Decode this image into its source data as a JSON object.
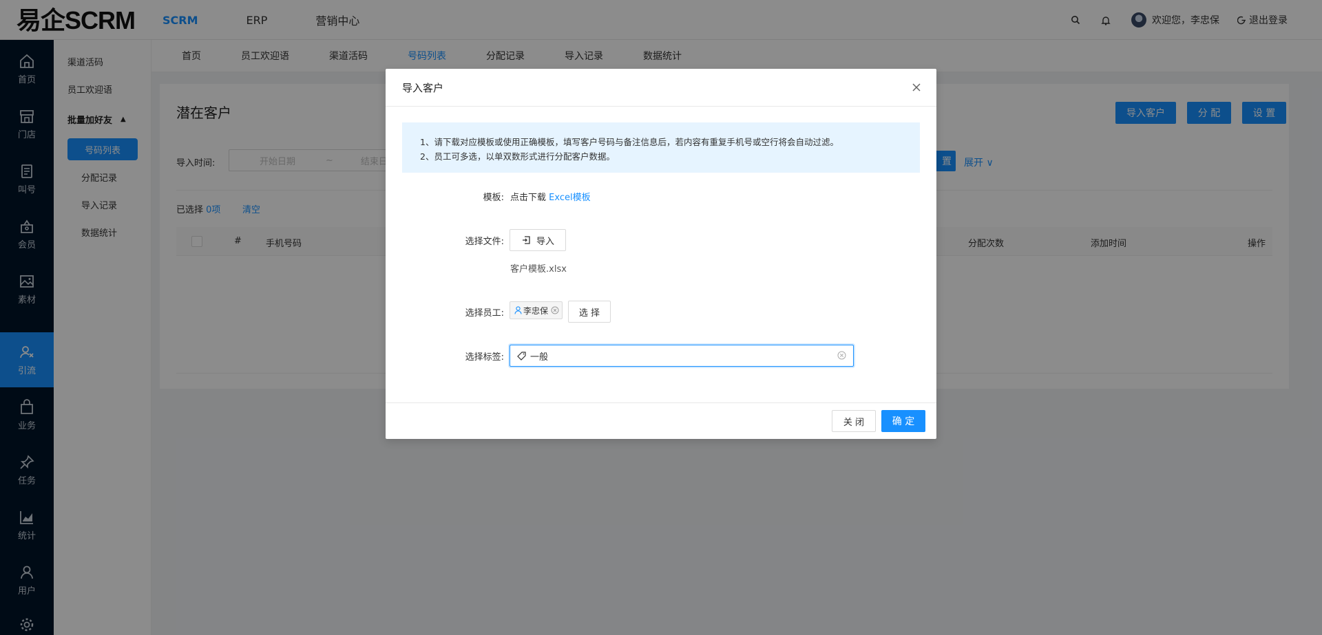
{
  "header": {
    "logo": "易企SCRM",
    "nav": [
      "SCRM",
      "ERP",
      "营销中心"
    ],
    "welcome": "欢迎您，李忠保",
    "logout": "退出登录"
  },
  "rail": {
    "items": [
      {
        "label": "首页",
        "icon": "home-icon"
      },
      {
        "label": "门店",
        "icon": "store-icon"
      },
      {
        "label": "叫号",
        "icon": "queue-icon"
      },
      {
        "label": "会员",
        "icon": "member-icon"
      },
      {
        "label": "素材",
        "icon": "image-icon"
      },
      {
        "label": "引流",
        "icon": "traffic-icon"
      },
      {
        "label": "业务",
        "icon": "bag-icon"
      },
      {
        "label": "任务",
        "icon": "pin-icon"
      },
      {
        "label": "统计",
        "icon": "chart-icon"
      },
      {
        "label": "用户",
        "icon": "user-icon"
      }
    ]
  },
  "submenu": {
    "items": [
      "渠道活码",
      "员工欢迎语"
    ],
    "group": "批量加好友",
    "children": [
      "号码列表",
      "分配记录",
      "导入记录",
      "数据统计"
    ]
  },
  "tabs": [
    "首页",
    "员工欢迎语",
    "渠道活码",
    "号码列表",
    "分配记录",
    "导入记录",
    "数据统计"
  ],
  "page": {
    "title": "潜在客户",
    "buttons": {
      "import": "导入客户",
      "assign": "分 配",
      "settings": "设 置"
    },
    "filter_label": "导入时间:",
    "date_start": "开始日期",
    "date_sep": "~",
    "date_end": "结束日",
    "reset_partial": "置",
    "expand": "展开",
    "selected_prefix": "已选择",
    "selected_count": "0项",
    "clear": "清空",
    "columns": [
      "#",
      "手机号码",
      "分配次数",
      "添加时间",
      "操作"
    ]
  },
  "modal": {
    "title": "导入客户",
    "notice_1": "1、请下载对应模板或使用正确模板，填写客户号码与备注信息后，若内容有重复手机号或空行将会自动过滤。",
    "notice_2": "2、员工可多选，以单双数形式进行分配客户数据。",
    "template_label": "模板:",
    "template_text": "点击下载",
    "template_link": "Excel模板",
    "file_label": "选择文件:",
    "import_button": "导入",
    "file_name": "客户模板.xlsx",
    "staff_label": "选择员工:",
    "staff_tag": "李忠保",
    "select_button": "选 择",
    "tag_label": "选择标签:",
    "tag_value": "一般",
    "close_button": "关 闭",
    "ok_button": "确 定"
  },
  "colors": {
    "primary": "#1890ff",
    "rail_bg": "#001529"
  }
}
